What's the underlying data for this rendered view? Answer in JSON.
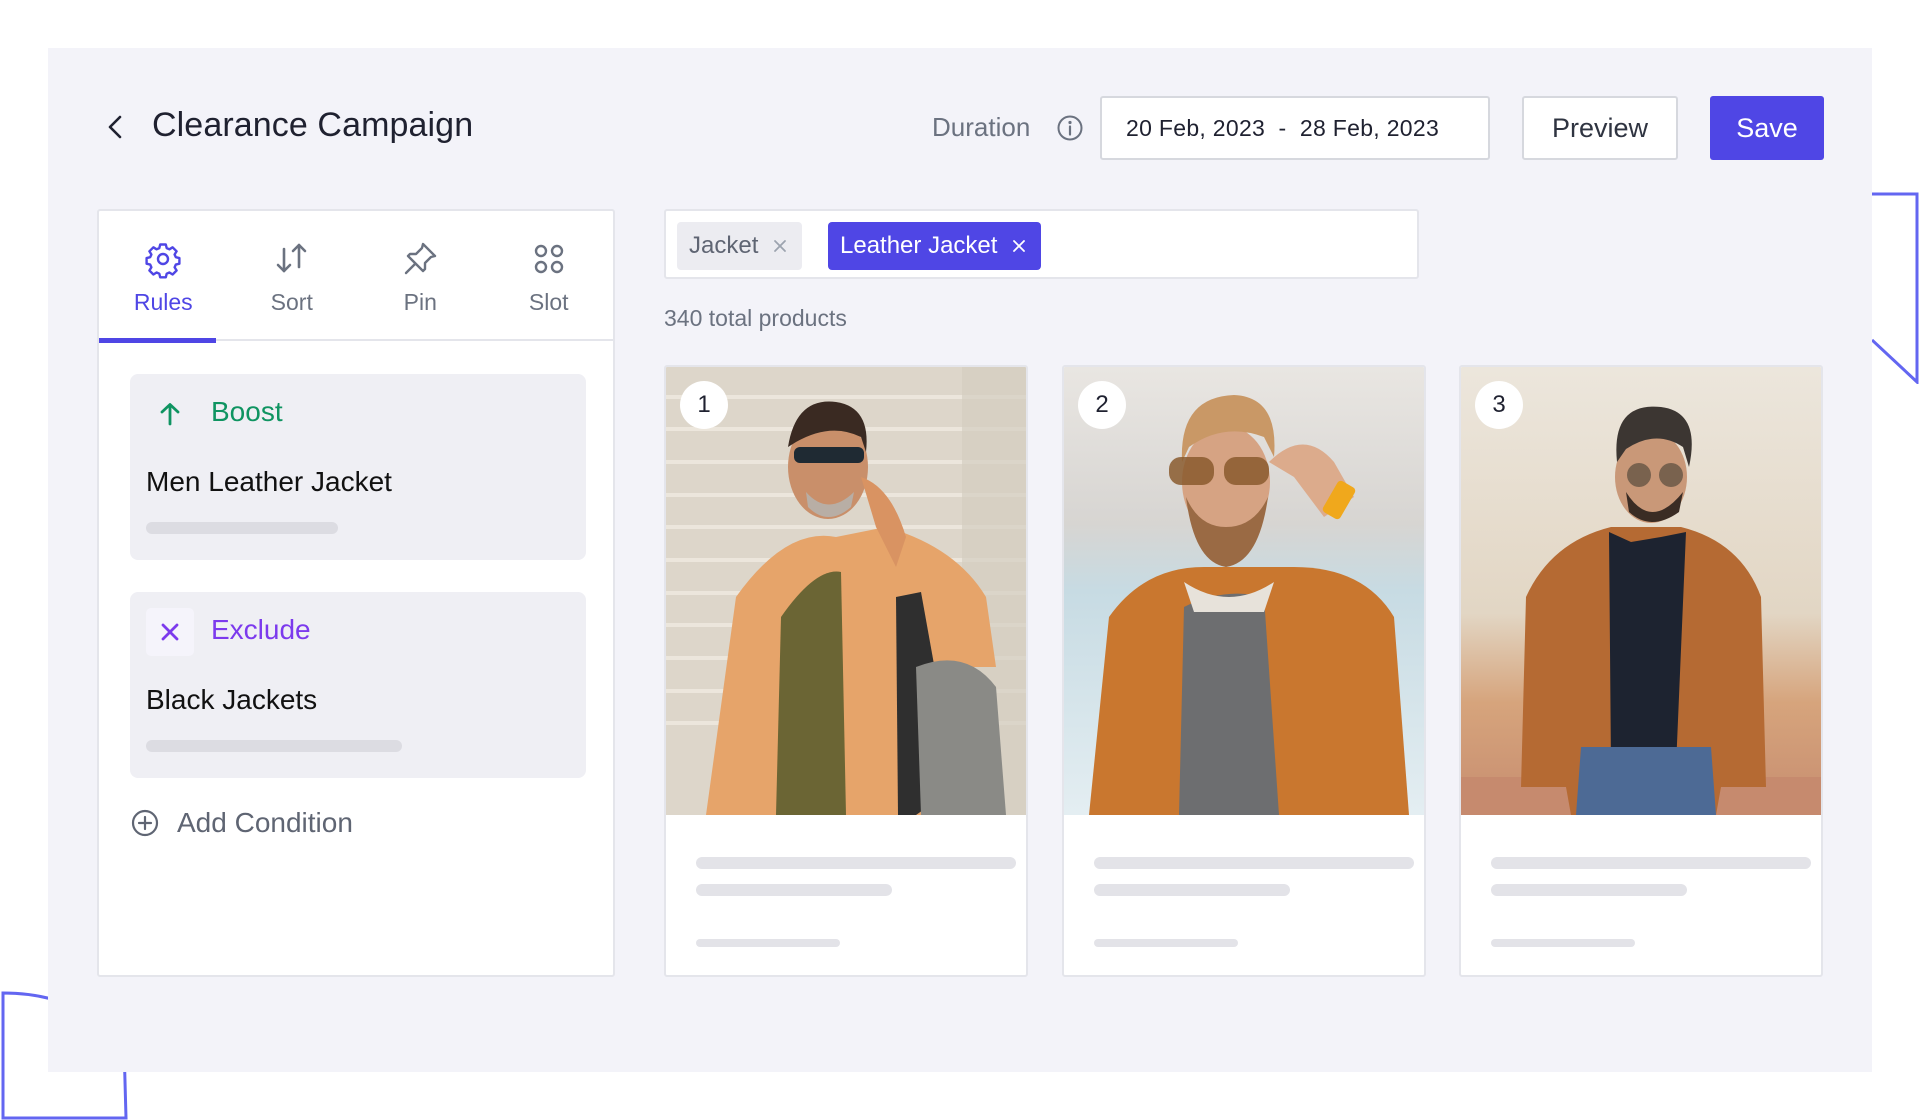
{
  "header": {
    "back_icon": "chevron-left-icon",
    "title": "Clearance Campaign",
    "duration_label": "Duration",
    "duration_info_icon": "info-circle-icon",
    "date_range": {
      "start": "20 Feb, 2023",
      "separator": "-",
      "end": "28 Feb, 2023"
    },
    "preview_label": "Preview",
    "save_label": "Save"
  },
  "colors": {
    "accent": "#4f46e5",
    "boost": "#0f9461",
    "exclude": "#7c3aed",
    "background": "#f3f3f9"
  },
  "sidebar": {
    "tabs": [
      {
        "label": "Rules",
        "icon": "gear-icon",
        "active": true
      },
      {
        "label": "Sort",
        "icon": "sort-arrows-icon",
        "active": false
      },
      {
        "label": "Pin",
        "icon": "pin-icon",
        "active": false
      },
      {
        "label": "Slot",
        "icon": "grid-circles-icon",
        "active": false
      }
    ],
    "rules": [
      {
        "type": "Boost",
        "icon": "arrow-up-icon",
        "name": "Men Leather Jacket"
      },
      {
        "type": "Exclude",
        "icon": "close-icon",
        "name": "Black Jackets"
      }
    ],
    "add_condition_label": "Add Condition",
    "add_condition_icon": "plus-circle-icon"
  },
  "filters": {
    "chips": [
      {
        "label": "Jacket",
        "selected": false
      },
      {
        "label": "Leather Jacket",
        "selected": true
      }
    ]
  },
  "results": {
    "total_text": "340 total products",
    "products": [
      {
        "rank": "1",
        "image": "man in tan leather jacket with sunglasses talking on phone, carrying backpack"
      },
      {
        "rank": "2",
        "image": "bearded man adjusting sunglasses in brown leather jacket"
      },
      {
        "rank": "3",
        "image": "man in brown suede jacket with aviator sunglasses and jeans"
      }
    ]
  }
}
